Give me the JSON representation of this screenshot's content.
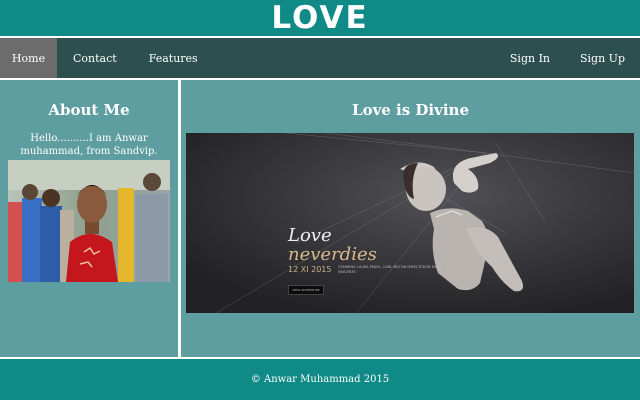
{
  "header": {
    "logo": "LOVE"
  },
  "nav": {
    "left": [
      {
        "label": "Home",
        "active": true
      },
      {
        "label": "Contact"
      },
      {
        "label": "Features"
      }
    ],
    "right": [
      {
        "label": "Sign In"
      },
      {
        "label": "Sign Up"
      }
    ]
  },
  "sidebar": {
    "title": "About Me",
    "text": "Hello..........I am Anwar muhammad, from Sandvip."
  },
  "main": {
    "title": "Love is Divine",
    "banner": {
      "title_line1": "Love",
      "title_line2": "neverdies",
      "date": "12 XI 2015",
      "credits": "STARRING LAURA PEARL, CARL MILTON DIRECTED BY MARK VINCENTE",
      "button": "VIEW ADVENTURE"
    }
  },
  "footer": {
    "text": "© Anwar Muhammad 2015"
  },
  "colors": {
    "header": "#0f8a87",
    "navbar": "#2e4f4f",
    "nav_active": "#6c6c6c",
    "panel": "#5f9ea0",
    "footer": "#0f8a87"
  }
}
